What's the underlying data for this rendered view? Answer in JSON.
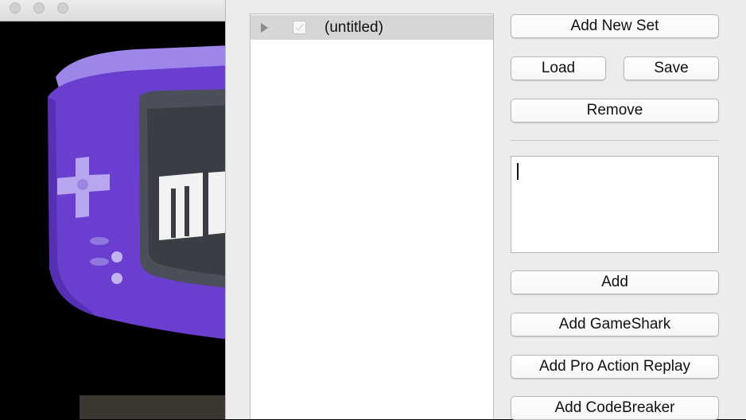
{
  "cheat_list": {
    "items": [
      {
        "label": "(untitled)",
        "enabled": true
      }
    ]
  },
  "set_buttons": {
    "add_new_set": "Add New Set",
    "load": "Load",
    "save": "Save",
    "remove": "Remove"
  },
  "code_input": {
    "value": ""
  },
  "add_buttons": {
    "add": "Add",
    "add_gameshark": "Add GameShark",
    "add_pro_action_replay": "Add Pro Action Replay",
    "add_codebreaker": "Add CodeBreaker"
  },
  "colors": {
    "panel_background": "#ececec",
    "selected_row": "#d6d6d6",
    "console_body": "#6a3fd0"
  },
  "icons": [
    "disclosure-triangle-icon",
    "checkbox-icon"
  ]
}
